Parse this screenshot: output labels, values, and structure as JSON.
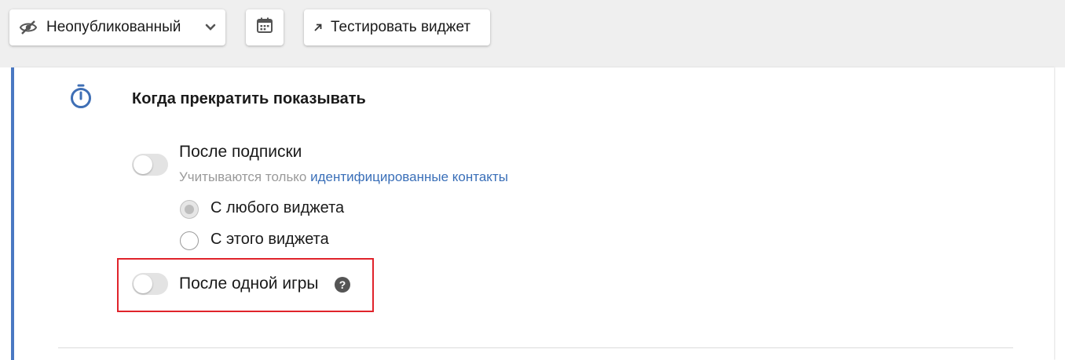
{
  "toolbar": {
    "status_label": "Неопубликованный",
    "status_icon": "eye-slash-icon",
    "calendar_icon": "calendar-icon",
    "test_label": "Тестировать виджет",
    "test_icon": "external-arrow-icon"
  },
  "section": {
    "icon": "stopwatch-icon",
    "title": "Когда прекратить показывать",
    "accent_color": "#4a78c2"
  },
  "options": {
    "after_subscription": {
      "label": "После подписки",
      "enabled": false,
      "hint_prefix": "Учитываются только ",
      "hint_link": "идентифицированные контакты",
      "radios": [
        {
          "label": "С любого виджета",
          "selected": true
        },
        {
          "label": "С этого виджета",
          "selected": false
        }
      ]
    },
    "after_one_game": {
      "label": "После одной игры",
      "enabled": false,
      "help_icon": "question-circle-icon",
      "help_glyph": "?",
      "highlight_color": "#e0232b"
    }
  }
}
